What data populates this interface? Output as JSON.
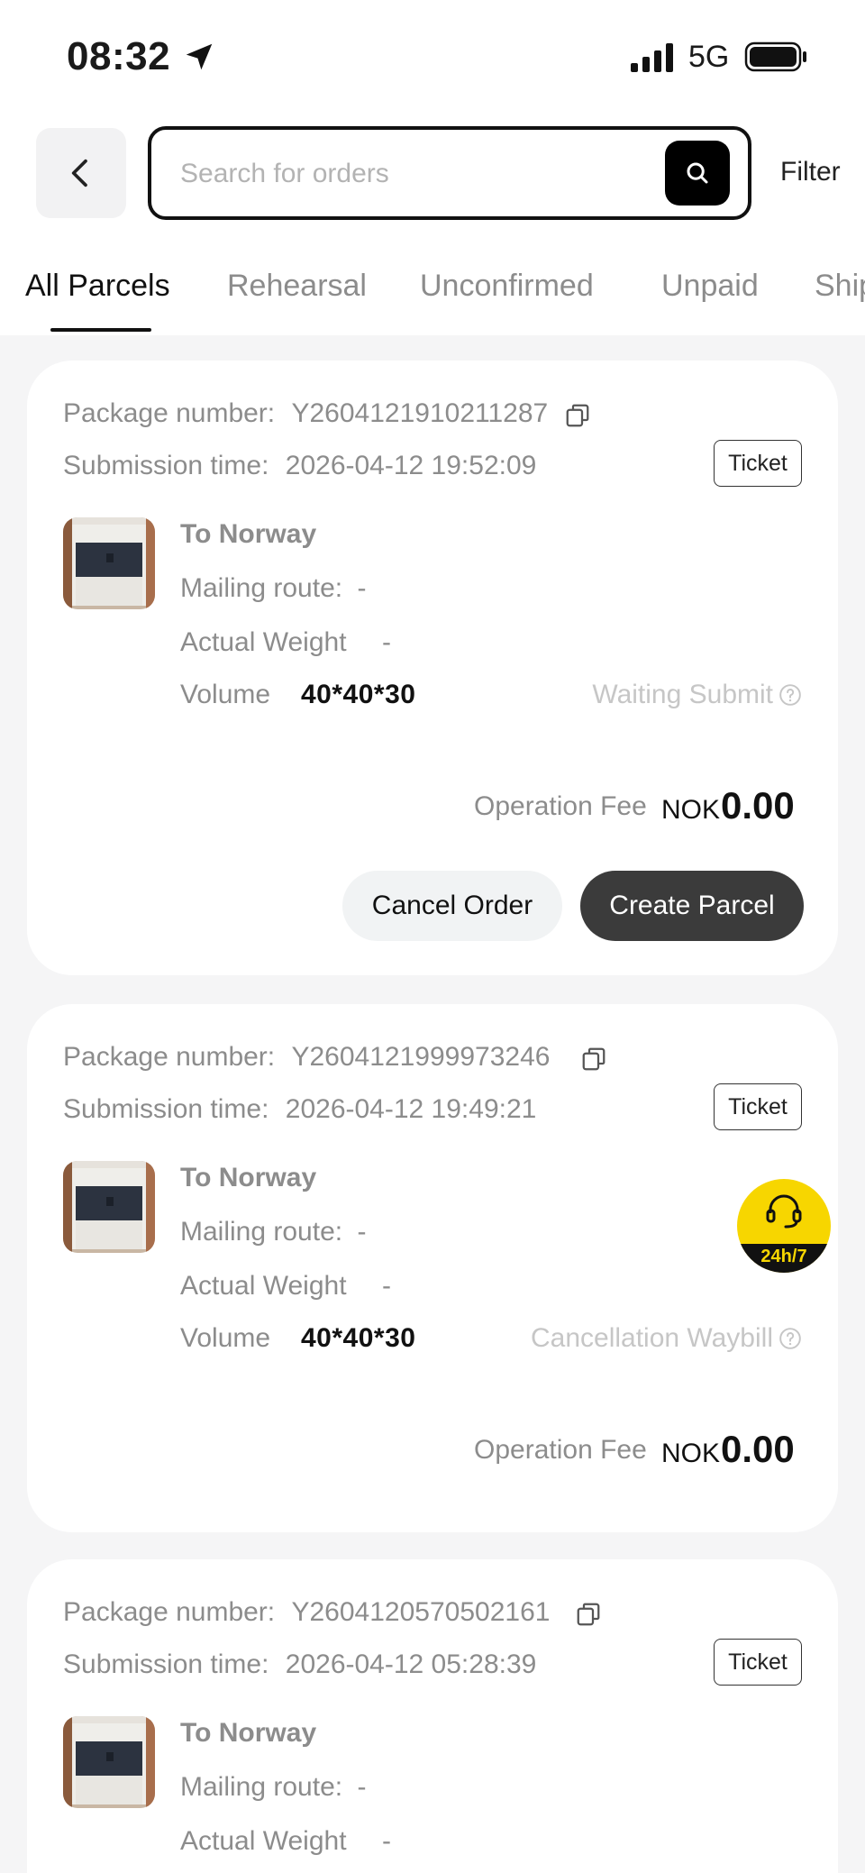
{
  "status_bar": {
    "time": "08:32",
    "network": "5G"
  },
  "header": {
    "search_placeholder": "Search for orders",
    "filter_label": "Filter"
  },
  "tabs": [
    {
      "label": "All Parcels",
      "active": true
    },
    {
      "label": "Rehearsal",
      "active": false
    },
    {
      "label": "Unconfirmed",
      "active": false
    },
    {
      "label": "Unpaid",
      "active": false
    },
    {
      "label": "Ship",
      "active": false
    }
  ],
  "labels": {
    "package_number": "Package number:",
    "submission_time": "Submission time:",
    "ticket": "Ticket",
    "mailing_route": "Mailing route:",
    "actual_weight": "Actual Weight",
    "volume": "Volume",
    "operation_fee": "Operation Fee",
    "cancel_order": "Cancel Order",
    "create_parcel": "Create Parcel"
  },
  "orders": [
    {
      "package_number": "Y2604121910211287",
      "submission_time": "2026-04-12 19:52:09",
      "destination": "To Norway",
      "mailing_route": "-",
      "actual_weight": "-",
      "volume": "40*40*30",
      "status": "Waiting Submit",
      "fee_currency": "NOK",
      "fee_amount": "0.00"
    },
    {
      "package_number": "Y2604121999973246",
      "submission_time": "2026-04-12 19:49:21",
      "destination": "To Norway",
      "mailing_route": "-",
      "actual_weight": "-",
      "volume": "40*40*30",
      "status": "Cancellation Waybill",
      "fee_currency": "NOK",
      "fee_amount": "0.00"
    },
    {
      "package_number": "Y2604120570502161",
      "submission_time": "2026-04-12 05:28:39",
      "destination": "To Norway",
      "mailing_route": "-",
      "actual_weight": "-"
    }
  ],
  "support": {
    "label": "24h/7"
  },
  "colors": {
    "accent_yellow": "#f7d600",
    "primary_dark": "#3b3b3b",
    "muted_text": "#8c8c8c",
    "status_text": "#c6c6c6",
    "background": "#f5f5f6"
  }
}
